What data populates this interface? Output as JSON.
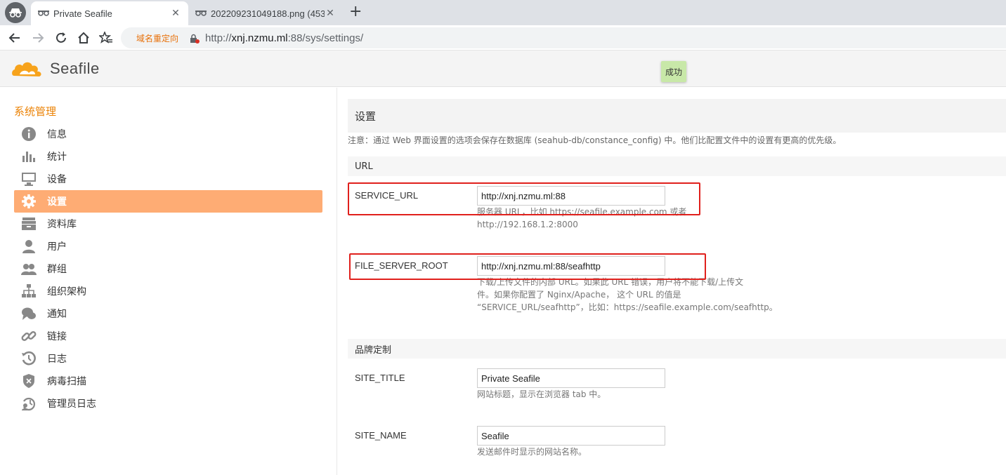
{
  "browser": {
    "tabs": [
      {
        "title": "Private Seafile",
        "active": true
      },
      {
        "title": "202209231049188.png (453",
        "active": false
      }
    ],
    "new_tab": "+",
    "close": "✕",
    "redirect_label": "域名重定向",
    "url_host": "xnj.nzmu.ml",
    "url_prefix": "http://",
    "url_suffix": ":88/sys/settings/"
  },
  "header": {
    "logo_text": "Seafile",
    "toast": "成功"
  },
  "sidebar": {
    "heading": "系统管理",
    "items": [
      {
        "label": "信息",
        "icon": "info-icon"
      },
      {
        "label": "统计",
        "icon": "bar-chart-icon"
      },
      {
        "label": "设备",
        "icon": "monitor-icon"
      },
      {
        "label": "设置",
        "icon": "gear-icon",
        "active": true
      },
      {
        "label": "资料库",
        "icon": "library-icon"
      },
      {
        "label": "用户",
        "icon": "user-icon"
      },
      {
        "label": "群组",
        "icon": "group-icon"
      },
      {
        "label": "组织架构",
        "icon": "org-chart-icon"
      },
      {
        "label": "通知",
        "icon": "chat-icon"
      },
      {
        "label": "链接",
        "icon": "link-icon"
      },
      {
        "label": "日志",
        "icon": "history-icon"
      },
      {
        "label": "病毒扫描",
        "icon": "shield-icon"
      },
      {
        "label": "管理员日志",
        "icon": "admin-log-icon"
      }
    ]
  },
  "main": {
    "title": "设置",
    "note": "注意：通过 Web 界面设置的选项会保存在数据库 (seahub-db/constance_config) 中。他们比配置文件中的设置有更高的优先级。",
    "sections": {
      "url": "URL",
      "branding": "品牌定制"
    },
    "fields": {
      "service_url": {
        "label": "SERVICE_URL",
        "value": "http://xnj.nzmu.ml:88",
        "help1": "服务器 URL，比如 https://seafile.example.com 或者",
        "help2": "http://192.168.1.2:8000"
      },
      "file_server_root": {
        "label": "FILE_SERVER_ROOT",
        "value": "http://xnj.nzmu.ml:88/seafhttp",
        "help1": "下载/上传文件的内部 URL。如果此 URL 错误，用户将不能下载/上传文",
        "help2": "件。如果你配置了 Nginx/Apache， 这个 URL 的值是",
        "help3": "“SERVICE_URL/seafhttp”，比如：https://seafile.example.com/seafhttp。"
      },
      "site_title": {
        "label": "SITE_TITLE",
        "value": "Private Seafile",
        "help1": "网站标题，显示在浏览器 tab 中。"
      },
      "site_name": {
        "label": "SITE_NAME",
        "value": "Seafile",
        "help1": "发送邮件时显示的网站名称。"
      }
    }
  }
}
